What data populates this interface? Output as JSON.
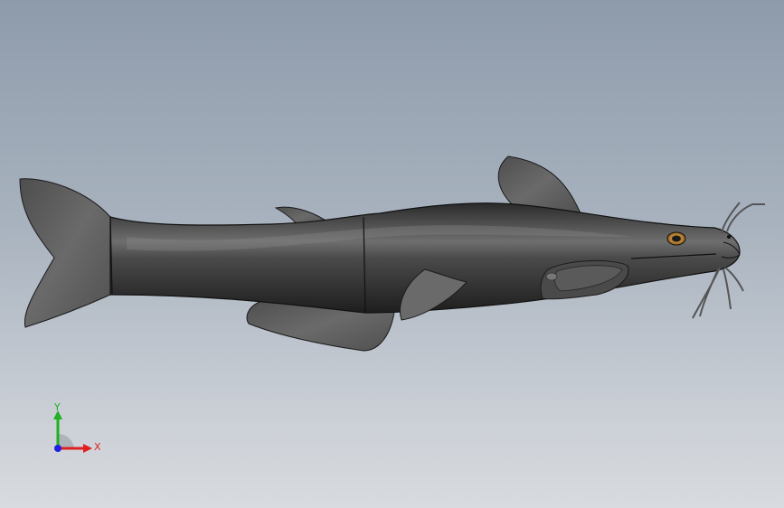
{
  "viewport": {
    "background_top": "#8e9bab",
    "background_bottom": "#d8dbdf"
  },
  "model": {
    "body_color": "#3a3a3a",
    "fin_color": "#5c5c5c",
    "eye_color": "#c8903a"
  },
  "triad": {
    "x_label": "X",
    "y_label": "Y",
    "x_color": "#e02020",
    "y_color": "#20b020",
    "z_color": "#2020e0"
  }
}
